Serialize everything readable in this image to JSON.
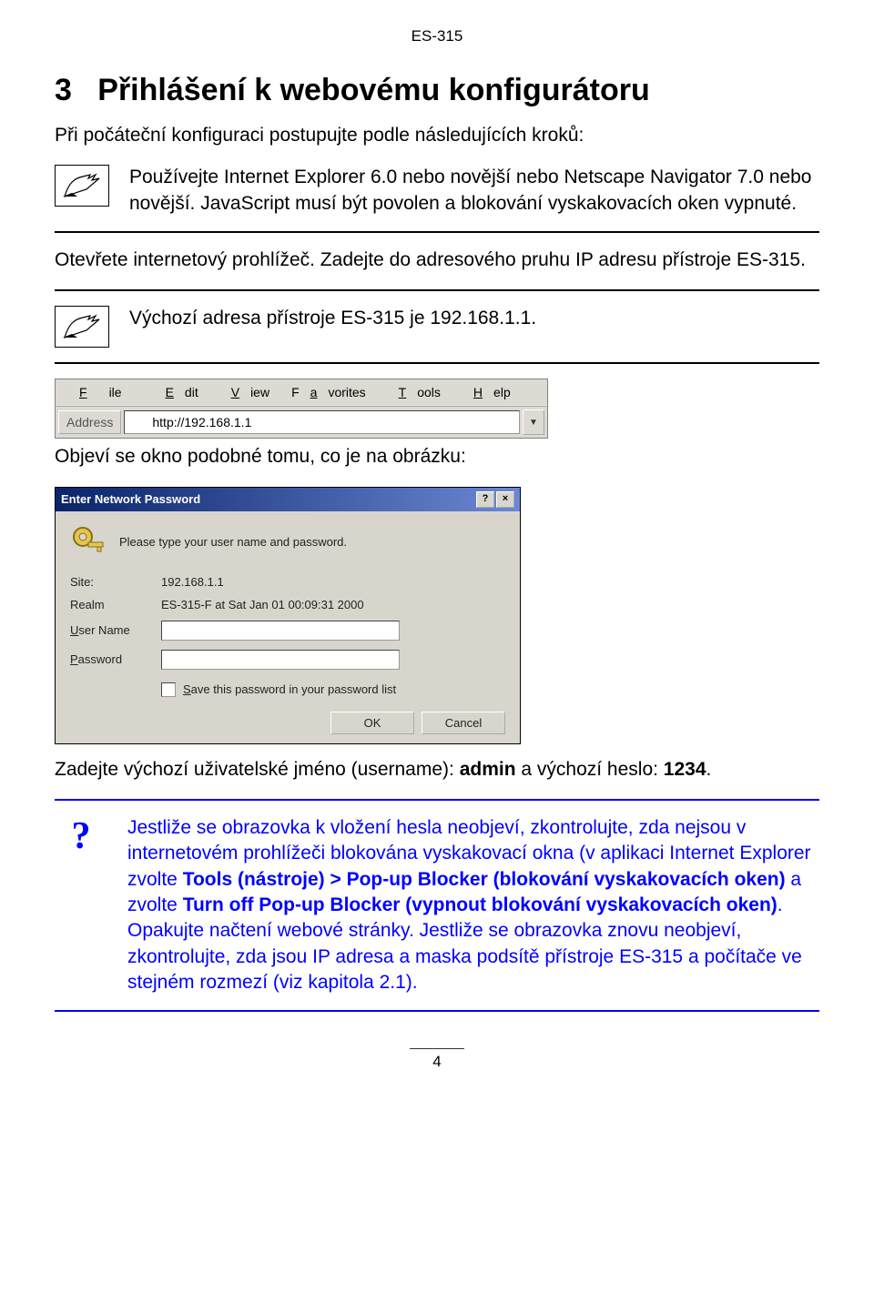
{
  "header": {
    "code": "ES-315"
  },
  "section": {
    "num": "3",
    "title": "Přihlášení k webovému konfigurátoru",
    "intro": "Při počáteční konfiguraci postupujte podle následujících kroků:",
    "note1": "Používejte Internet Explorer 6.0 nebo novější nebo Netscape Navigator 7.0 nebo novější. JavaScript musí být povolen a blokování vyskakovacích oken vypnuté.",
    "step_open": "Otevřete internetový prohlížeč. Zadejte do adresového pruhu IP adresu přístroje ES-315.",
    "note2": "Výchozí adresa přístroje ES-315 je 192.168.1.1.",
    "appears": "Objeví se okno podobné tomu, co je na obrázku:",
    "creds_prefix": "Zadejte výchozí uživatelské jméno (username): ",
    "creds_user": "admin",
    "creds_mid": " a výchozí heslo: ",
    "creds_pw": "1234",
    "creds_suffix": "."
  },
  "ie": {
    "menu": {
      "file": "File",
      "edit": "Edit",
      "view": "View",
      "fav": "Favorites",
      "tools": "Tools",
      "help": "Help"
    },
    "addr_label": "Address",
    "url": "http://192.168.1.1"
  },
  "dialog": {
    "title": "Enter Network Password",
    "prompt": "Please type your user name and password.",
    "site_label": "Site:",
    "site_value": "192.168.1.1",
    "realm_label": "Realm",
    "realm_value": "ES-315-F at Sat Jan 01 00:09:31 2000",
    "user_label": "User Name",
    "pass_label": "Password",
    "save_label": "Save this password in your password list",
    "ok": "OK",
    "cancel": "Cancel"
  },
  "troubleshoot": {
    "p1a": "Jestliže se obrazovka k vložení hesla neobjeví, zkontrolujte, zda nejsou v internetovém prohlížeči blokována vyskakovací okna (v aplikaci Internet Explorer zvolte ",
    "p1b": "Tools (nástroje) > Pop-up Blocker (blokování vyskakovacích oken)",
    "p1c": " a zvolte ",
    "p1d": "Turn off Pop-up Blocker (vypnout blokování vyskakovacích oken)",
    "p1e": ". Opakujte načtení webové stránky.",
    "p2": " Jestliže se obrazovka znovu neobjeví, zkontrolujte, zda jsou IP adresa a maska podsítě přístroje ES-315 a počítače ve stejném rozmezí (viz kapitola 2.1)."
  },
  "footer": {
    "page": "4"
  }
}
